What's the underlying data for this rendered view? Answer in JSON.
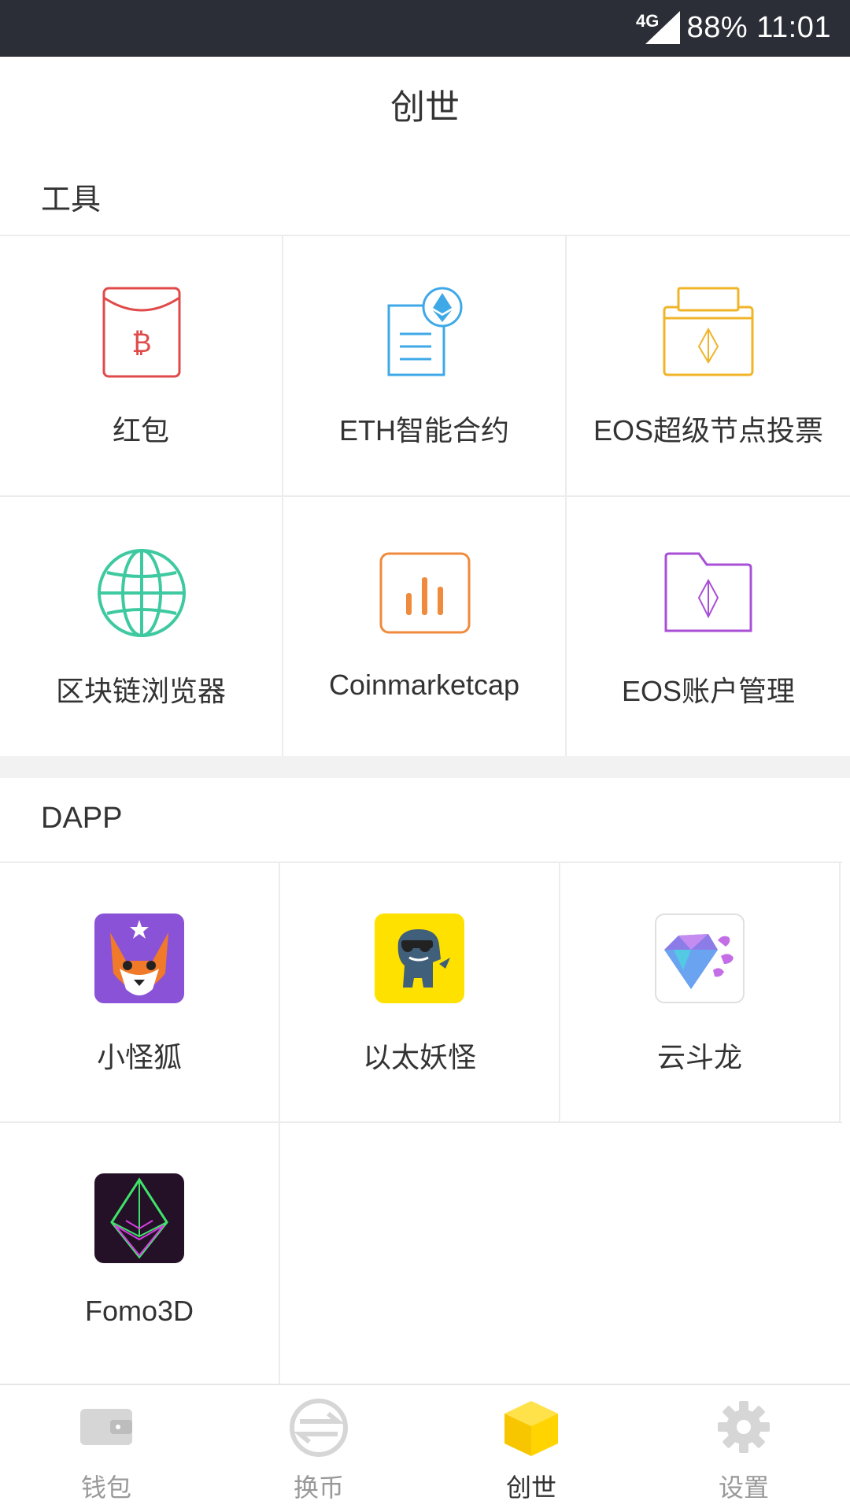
{
  "status_bar": {
    "network": "4G",
    "battery": "88%",
    "time": "11:01"
  },
  "page_title": "创世",
  "tools": {
    "section_title": "工具",
    "items": [
      {
        "label": "红包",
        "icon": "red-envelope-icon",
        "color": "#e04a4a"
      },
      {
        "label": "ETH智能合约",
        "icon": "eth-contract-icon",
        "color": "#3fa9e8"
      },
      {
        "label": "EOS超级节点投票",
        "icon": "ballot-box-icon",
        "color": "#f0b429"
      },
      {
        "label": "区块链浏览器",
        "icon": "globe-icon",
        "color": "#3ec9a0"
      },
      {
        "label": "Coinmarketcap",
        "icon": "bar-chart-icon",
        "color": "#f08a3c"
      },
      {
        "label": "EOS账户管理",
        "icon": "folder-icon",
        "color": "#a94fd6"
      }
    ]
  },
  "dapp": {
    "section_title": "DAPP",
    "items": [
      {
        "label": "小怪狐",
        "icon": "fox-app-icon"
      },
      {
        "label": "以太妖怪",
        "icon": "dinosaur-app-icon"
      },
      {
        "label": "云斗龙",
        "icon": "crystal-app-icon"
      },
      {
        "label": "Fomo3D",
        "icon": "fomo3d-app-icon"
      }
    ]
  },
  "tabbar": {
    "active": "创世",
    "items": [
      {
        "label": "钱包",
        "icon": "wallet-icon"
      },
      {
        "label": "换币",
        "icon": "exchange-icon"
      },
      {
        "label": "创世",
        "icon": "cube-icon"
      },
      {
        "label": "设置",
        "icon": "gear-icon"
      }
    ]
  }
}
